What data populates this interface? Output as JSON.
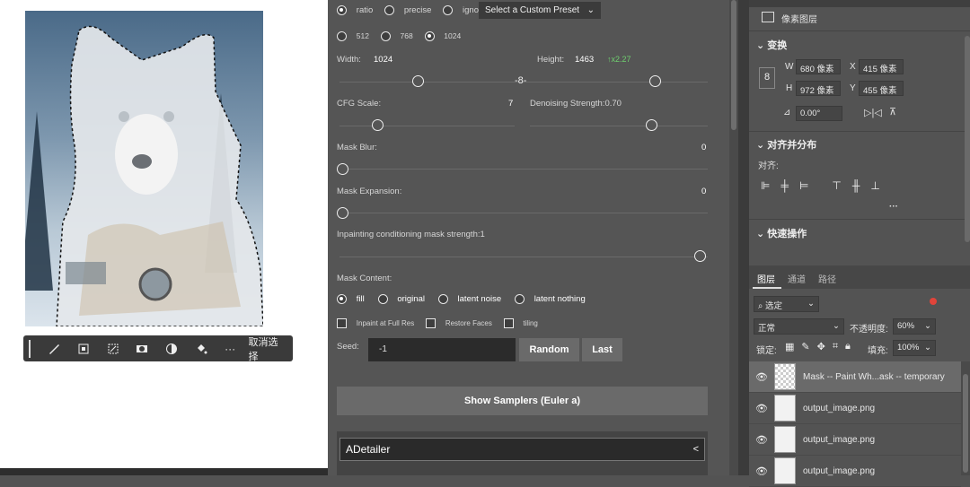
{
  "canvas": {
    "context_toolbar": {
      "tools": [
        "brush-icon",
        "mask-add-icon",
        "mask-subtract-icon",
        "mask-icon",
        "invert-icon",
        "fill-icon",
        "more-icon"
      ],
      "more_label": "···",
      "deselect_label": "取消选择"
    }
  },
  "sd_panel": {
    "ratio_options": [
      "ratio",
      "precise",
      "ignore"
    ],
    "ratio_selected": "ratio",
    "preset_label": "Select a Custom Preset",
    "size_options": [
      "512",
      "768",
      "1024"
    ],
    "size_selected": "1024",
    "width_label": "Width:",
    "width_value": "1024",
    "height_label": "Height:",
    "height_value": "1463",
    "scale_text": "↑x2.27",
    "cfg_label": "CFG Scale:",
    "cfg_value": "7",
    "denoise_label": "Denoising Strength:0.70",
    "mask_blur_label": "Mask Blur:",
    "mask_blur_value": "0",
    "mask_expansion_label": "Mask Expansion:",
    "mask_expansion_value": "0",
    "inpaint_strength_label": "Inpainting conditioning mask strength:1",
    "mask_content_label": "Mask Content:",
    "mask_content_options": [
      "fill",
      "original",
      "latent noise",
      "latent nothing"
    ],
    "mask_content_selected": "fill",
    "inpaint_full_res_label": "Inpaint at Full Res",
    "restore_faces_label": "Restore Faces",
    "tiling_label": "tiling",
    "seed_label": "Seed:",
    "seed_value": "-1",
    "random_label": "Random",
    "last_label": "Last",
    "show_samplers_label": "Show Samplers (Euler a)",
    "adetailer_label": "ADetailer",
    "adetailer_chevron": "<",
    "sliders": {
      "width": 0.22,
      "height": 0.85,
      "cfg": 0.1,
      "denoise": 0.7,
      "mask_blur": 0,
      "mask_expansion": 0,
      "inpaint_strength": 1
    }
  },
  "properties": {
    "layer_type": "像素图层",
    "transform_header": "变换",
    "w_label": "W",
    "w_value": "680 像素",
    "x_label": "X",
    "x_value": "415 像素",
    "h_label": "H",
    "h_value": "972 像素",
    "y_label": "Y",
    "y_value": "455 像素",
    "angle_value": "0.00°",
    "align_header": "对齐并分布",
    "align_label": "对齐:",
    "align_more": "···",
    "quick_actions_header": "快速操作"
  },
  "layers_panel": {
    "tabs": [
      "图层",
      "通道",
      "路径"
    ],
    "active_tab": "图层",
    "filter_label": "选定",
    "blend_mode": "正常",
    "opacity_label": "不透明度:",
    "opacity_value": "60%",
    "lock_label": "锁定:",
    "fill_label": "填充:",
    "fill_value": "100%",
    "layers": [
      {
        "name": "Mask -- Paint Wh...ask -- temporary",
        "selected": true
      },
      {
        "name": "output_image.png",
        "selected": false
      },
      {
        "name": "output_image.png",
        "selected": false
      },
      {
        "name": "output_image.png",
        "selected": false
      }
    ]
  },
  "colors": {
    "panel_bg": "#535353",
    "accent_green": "#6fcf6f",
    "red_dot": "#e0443a"
  }
}
